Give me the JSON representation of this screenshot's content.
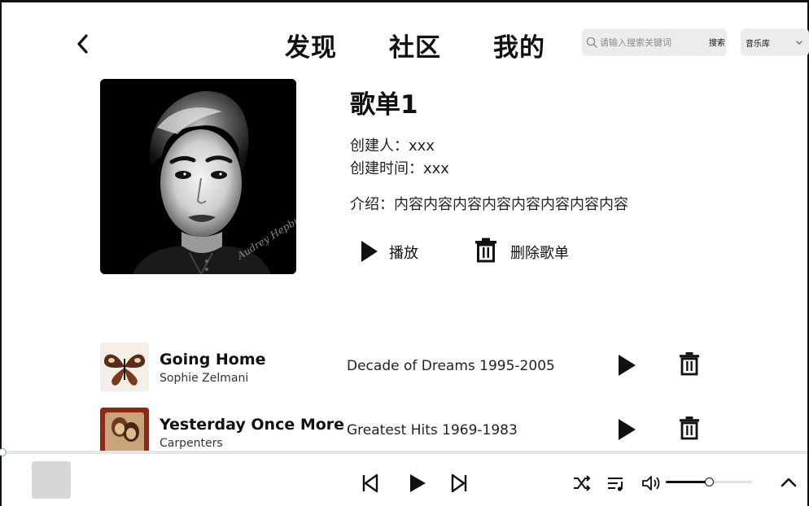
{
  "header": {
    "back_icon": "chevron-left-icon",
    "tabs": [
      "发现",
      "社区",
      "我的"
    ],
    "search": {
      "placeholder": "请输入搜索关键词",
      "button_label": "搜索",
      "icon": "search-icon"
    },
    "library_select": {
      "selected": "音乐库",
      "icon": "chevron-down-icon"
    }
  },
  "playlist": {
    "title": "歌单1",
    "creator_line": "创建人：xxx",
    "created_time_line": "创建时间：xxx",
    "intro_line": "介绍：内容内容内容内容内容内容内容内容",
    "play_label": "播放",
    "delete_label": "删除歌单",
    "cover_text": "Audrey Hepburn"
  },
  "songs": [
    {
      "title": "Going Home",
      "artist": "Sophie Zelmani",
      "album": "Decade of Dreams 1995-2005"
    },
    {
      "title": "Yesterday Once More",
      "artist": "Carpenters",
      "album": "Greatest Hits 1969-1983"
    }
  ],
  "player": {
    "progress": 0.0,
    "volume": 0.5,
    "icons": [
      "skip-previous-icon",
      "play-icon",
      "skip-next-icon",
      "shuffle-icon",
      "queue-icon",
      "volume-icon",
      "chevron-up-icon"
    ]
  },
  "colors": {
    "text": "#111111",
    "search_bg": "#ececec",
    "progress_knob": "#7a9bd6"
  }
}
